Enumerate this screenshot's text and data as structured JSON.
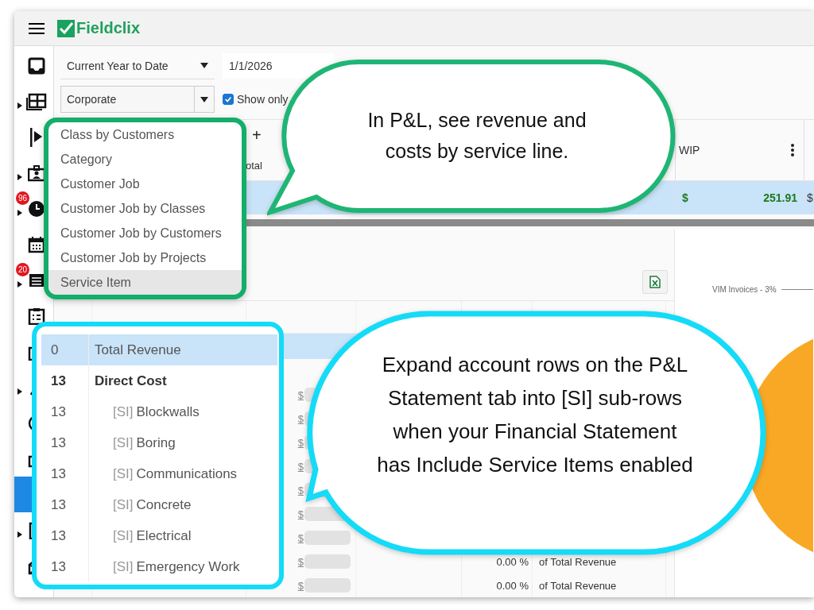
{
  "header": {
    "logo": "Fieldclix"
  },
  "sidebar": {
    "items": [
      {
        "kind": "inbox",
        "expandable": false,
        "selected": false
      },
      {
        "kind": "table",
        "expandable": true,
        "selected": false
      },
      {
        "kind": "play",
        "expandable": false,
        "selected": false
      },
      {
        "kind": "idcard",
        "expandable": true,
        "selected": false
      },
      {
        "kind": "clock",
        "expandable": true,
        "selected": false,
        "badge": "96"
      },
      {
        "kind": "calendar",
        "expandable": false,
        "selected": false
      },
      {
        "kind": "list",
        "expandable": true,
        "selected": false,
        "badge": "20"
      },
      {
        "kind": "clipboard",
        "expandable": false,
        "selected": false
      },
      {
        "kind": "copy",
        "expandable": false,
        "selected": false
      },
      {
        "kind": "chart",
        "expandable": true,
        "selected": false
      },
      {
        "kind": "gauge",
        "expandable": false,
        "selected": false
      },
      {
        "kind": "stack",
        "expandable": false,
        "selected": false
      },
      {
        "kind": "blank",
        "expandable": false,
        "selected": true
      },
      {
        "kind": "building",
        "expandable": true,
        "selected": false
      },
      {
        "kind": "mail",
        "expandable": false,
        "selected": false
      }
    ]
  },
  "filters": {
    "period": "Current Year to Date",
    "from_date": "1/1/2026",
    "class": "Corporate",
    "show_only": {
      "label": "Show only",
      "checked": true
    }
  },
  "class_dropdown": {
    "items": [
      {
        "label": "Class by Customers",
        "selected": false
      },
      {
        "label": "Category",
        "selected": false
      },
      {
        "label": "Customer Job",
        "selected": false
      },
      {
        "label": "Customer Job by Classes",
        "selected": false
      },
      {
        "label": "Customer Job by Customers",
        "selected": false
      },
      {
        "label": "Customer Job by Projects",
        "selected": false
      },
      {
        "label": "Service Item",
        "selected": true
      }
    ]
  },
  "summary_grid": {
    "add": "+",
    "column_2": "otal",
    "wip_column": "WIP",
    "row": {
      "wip_currency": "$",
      "wip": "251.91",
      "next_currency": "$"
    }
  },
  "statement": {
    "rows": [
      {
        "currency": ""
      },
      {
        "currency": ""
      },
      {
        "currency": "$"
      },
      {
        "currency": "$"
      },
      {
        "currency": "$"
      },
      {
        "currency": "$"
      },
      {
        "currency": "$"
      },
      {
        "currency": "$"
      },
      {
        "currency": "$"
      },
      {
        "currency": "$",
        "percent": "0.00 %",
        "basis": "of Total Revenue"
      },
      {
        "currency": "$",
        "percent": "0.00 %",
        "basis": "of Total Revenue"
      }
    ]
  },
  "inset": {
    "rows": [
      {
        "kind": "total",
        "code": "0",
        "name": "Total Revenue",
        "selected": true
      },
      {
        "kind": "group",
        "code": "13",
        "name": "Direct Cost",
        "selected": false
      },
      {
        "kind": "sub",
        "code": "13",
        "tag": "[SI]",
        "name": "Blockwalls",
        "selected": false
      },
      {
        "kind": "sub",
        "code": "13",
        "tag": "[SI]",
        "name": "Boring",
        "selected": false
      },
      {
        "kind": "sub",
        "code": "13",
        "tag": "[SI]",
        "name": "Communications",
        "selected": false
      },
      {
        "kind": "sub",
        "code": "13",
        "tag": "[SI]",
        "name": "Concrete",
        "selected": false
      },
      {
        "kind": "sub",
        "code": "13",
        "tag": "[SI]",
        "name": "Electrical",
        "selected": false
      },
      {
        "kind": "sub",
        "code": "13",
        "tag": "[SI]",
        "name": "Emergency Work",
        "selected": false
      }
    ]
  },
  "chart": {
    "label": "VIM Invoices - 3%"
  },
  "callouts": [
    {
      "text": "In P&L, see revenue and costs by service line."
    },
    {
      "text": "Expand account rows on the P&L Statement tab into [SI] sub-rows when your Financial Statement has Include Service Items enabled"
    }
  ]
}
